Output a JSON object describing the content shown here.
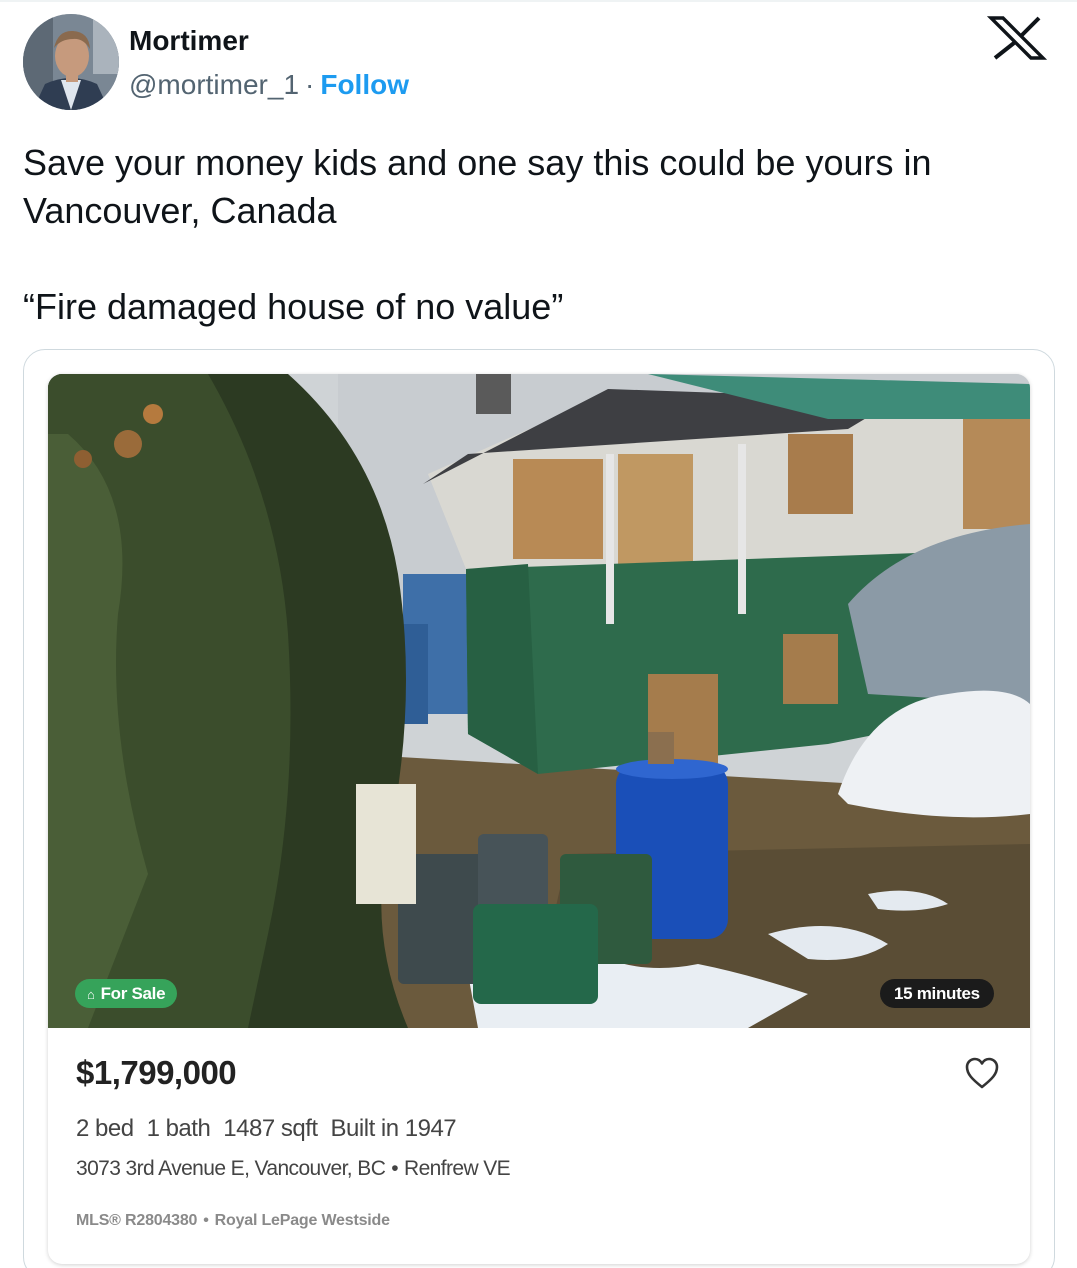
{
  "tweet": {
    "author_name": "Mortimer",
    "handle": "@mortimer_1",
    "separator": "·",
    "follow_label": "Follow",
    "text": "Save your money kids and one say this could be yours in Vancouver, Canada\n\n“Fire damaged house of no value”"
  },
  "listing": {
    "status_badge": "For Sale",
    "time_badge": "15 minutes",
    "price": "$1,799,000",
    "beds": "2 bed",
    "baths": "1 bath",
    "sqft": "1487 sqft",
    "built": "Built in 1947",
    "address": "3073 3rd Avenue E, Vancouver, BC",
    "neighborhood": "Renfrew VE",
    "bullet": "•",
    "mls_label": "MLS®",
    "mls_number": "R2804380",
    "brokerage": "Royal LePage Westside"
  },
  "icons": {
    "logo": "x-logo-icon",
    "favorite": "heart-icon",
    "home": "home-icon"
  },
  "colors": {
    "follow": "#1d9bf0",
    "for_sale_badge": "#36a35a",
    "time_badge": "#1b1b1b"
  }
}
